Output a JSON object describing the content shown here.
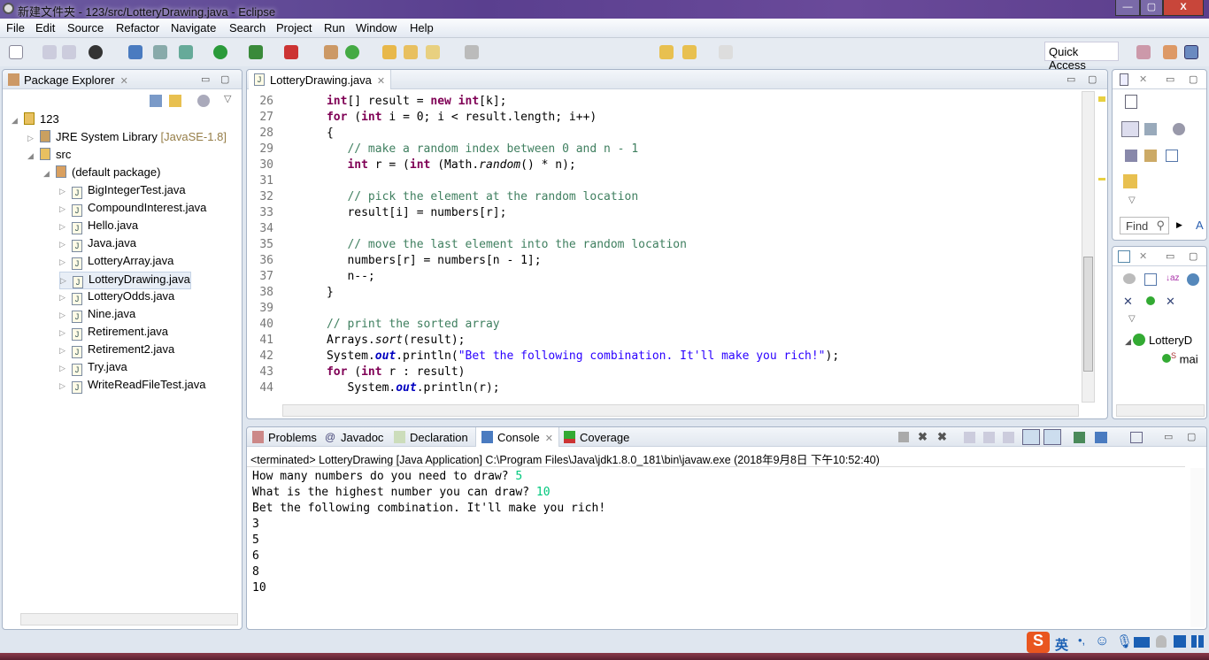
{
  "window": {
    "title": "新建文件夹 - 123/src/LotteryDrawing.java - Eclipse",
    "min": "—",
    "max": "▢",
    "close": "X"
  },
  "menu": [
    "File",
    "Edit",
    "Source",
    "Refactor",
    "Navigate",
    "Search",
    "Project",
    "Run",
    "Window",
    "Help"
  ],
  "toolbar": {
    "quick_access": "Quick Access"
  },
  "package_explorer": {
    "title": "Package Explorer",
    "project": "123",
    "jre": "JRE System Library",
    "jre_version": "[JavaSE-1.8]",
    "src": "src",
    "package": "(default package)",
    "files": [
      "BigIntegerTest.java",
      "CompoundInterest.java",
      "Hello.java",
      "Java.java",
      "LotteryArray.java",
      "LotteryDrawing.java",
      "LotteryOdds.java",
      "Nine.java",
      "Retirement.java",
      "Retirement2.java",
      "Try.java",
      "WriteReadFileTest.java"
    ],
    "selected": "LotteryDrawing.java"
  },
  "editor": {
    "tab": "LotteryDrawing.java",
    "lines": [
      {
        "n": "26",
        "t": [
          [
            "kw",
            "      int"
          ],
          [
            "",
            "[] result = "
          ],
          [
            "kw",
            "new int"
          ],
          [
            "",
            "[k];"
          ]
        ]
      },
      {
        "n": "27",
        "t": [
          [
            "kw",
            "      for"
          ],
          [
            "",
            " ("
          ],
          [
            "kw",
            "int"
          ],
          [
            "",
            " i = 0; i < result.length; i++)"
          ]
        ]
      },
      {
        "n": "28",
        "t": [
          [
            "",
            "      {"
          ]
        ]
      },
      {
        "n": "29",
        "t": [
          [
            "cm",
            "         // make a random index between 0 and n - 1"
          ]
        ]
      },
      {
        "n": "30",
        "t": [
          [
            "kw",
            "         int"
          ],
          [
            "",
            " r = ("
          ],
          [
            "kw",
            "int"
          ],
          [
            "",
            " (Math."
          ],
          [
            "sm",
            "random"
          ],
          [
            "",
            "() * n);"
          ]
        ]
      },
      {
        "n": "31",
        "t": []
      },
      {
        "n": "32",
        "t": [
          [
            "cm",
            "         // pick the element at the random location"
          ]
        ]
      },
      {
        "n": "33",
        "t": [
          [
            "",
            "         result[i] = numbers[r];"
          ]
        ]
      },
      {
        "n": "34",
        "t": []
      },
      {
        "n": "35",
        "t": [
          [
            "cm",
            "         // move the last element into the random location"
          ]
        ]
      },
      {
        "n": "36",
        "t": [
          [
            "",
            "         numbers[r] = numbers[n - 1];"
          ]
        ]
      },
      {
        "n": "37",
        "t": [
          [
            "",
            "         n--;"
          ]
        ]
      },
      {
        "n": "38",
        "t": [
          [
            "",
            "      }"
          ]
        ]
      },
      {
        "n": "39",
        "t": []
      },
      {
        "n": "40",
        "t": [
          [
            "cm",
            "      // print the sorted array"
          ]
        ]
      },
      {
        "n": "41",
        "t": [
          [
            "",
            "      Arrays."
          ],
          [
            "sm",
            "sort"
          ],
          [
            "",
            "(result);"
          ]
        ]
      },
      {
        "n": "42",
        "t": [
          [
            "",
            "      System."
          ],
          [
            "sf",
            "out"
          ],
          [
            "",
            ".println("
          ],
          [
            "st",
            "\"Bet the following combination. It'll make you rich!\""
          ],
          [
            "",
            ");"
          ]
        ]
      },
      {
        "n": "43",
        "t": [
          [
            "kw",
            "      for"
          ],
          [
            "",
            " ("
          ],
          [
            "kw",
            "int"
          ],
          [
            "",
            " r : result)"
          ]
        ]
      },
      {
        "n": "44",
        "t": [
          [
            "",
            "         System."
          ],
          [
            "sf",
            "out"
          ],
          [
            "",
            ".println(r);"
          ]
        ]
      }
    ]
  },
  "right": {
    "find_placeholder": "Find",
    "find_extra": "A",
    "outline_class": "LotteryD",
    "outline_method": "mai",
    "outline_mod": "S"
  },
  "console_tabs": [
    "Problems",
    "Javadoc",
    "Declaration",
    "Console",
    "Coverage"
  ],
  "console": {
    "status": "<terminated> LotteryDrawing [Java Application] C:\\Program Files\\Java\\jdk1.8.0_181\\bin\\javaw.exe (2018年9月8日 下午10:52:40)",
    "lines": [
      {
        "text": "How many numbers do you need to draw? ",
        "input": "5"
      },
      {
        "text": "What is the highest number you can draw? ",
        "input": "10"
      },
      {
        "text": "Bet the following combination. It'll make you rich!",
        "input": ""
      },
      {
        "text": "3",
        "input": ""
      },
      {
        "text": "5",
        "input": ""
      },
      {
        "text": "6",
        "input": ""
      },
      {
        "text": "8",
        "input": ""
      },
      {
        "text": "10",
        "input": ""
      }
    ]
  },
  "ime": {
    "lang": "英",
    "logo": "S"
  }
}
